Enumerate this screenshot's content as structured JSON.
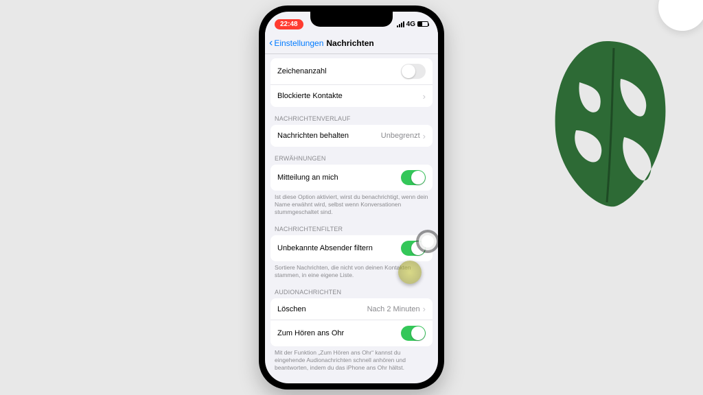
{
  "status": {
    "time": "22:48",
    "network": "4G"
  },
  "nav": {
    "back": "Einstellungen",
    "title": "Nachrichten"
  },
  "rows": {
    "charCount": {
      "label": "Zeichenanzahl",
      "on": false
    },
    "blocked": {
      "label": "Blockierte Kontakte"
    }
  },
  "history": {
    "header": "NACHRICHTENVERLAUF",
    "keep": {
      "label": "Nachrichten behalten",
      "value": "Unbegrenzt"
    }
  },
  "mentions": {
    "header": "ERWÄHNUNGEN",
    "notify": {
      "label": "Mitteilung an mich",
      "on": true
    },
    "footer": "Ist diese Option aktiviert, wirst du benachrichtigt, wenn dein Name erwähnt wird, selbst wenn Konversationen stummgeschaltet sind."
  },
  "filter": {
    "header": "NACHRICHTENFILTER",
    "unknown": {
      "label": "Unbekannte Absender filtern",
      "on": true
    },
    "footer": "Sortiere Nachrichten, die nicht von deinen Kontakten stammen, in eine eigene Liste."
  },
  "audio": {
    "header": "AUDIONACHRICHTEN",
    "expire": {
      "label": "Löschen",
      "value": "Nach 2 Minuten"
    },
    "raise": {
      "label": "Zum Hören ans Ohr",
      "on": true
    },
    "footer": "Mit der Funktion „Zum Hören ans Ohr“ kannst du eingehende Audionachrichten schnell anhören und beantworten, indem du das iPhone ans Ohr hältst."
  }
}
